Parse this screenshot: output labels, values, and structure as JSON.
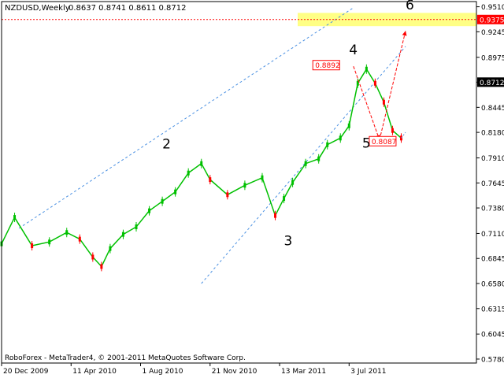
{
  "header": {
    "symbol": "NZDUSD,Weekly",
    "ohlc": "0.8637 0.8741 0.8611 0.8712"
  },
  "footer": {
    "copyright": "RoboForex - MetaTrader4, © 2001-2011 MetaQuotes Software Corp."
  },
  "colors": {
    "background": "#ffffff",
    "frame": "#000000",
    "bull": "#00c000",
    "bear": "#ff0000",
    "fractal": "#4a90e2",
    "channel": "#4a90e2",
    "level_line": "#ff0000",
    "target_zone": "#ffff66",
    "current_price_box": "#000000",
    "level_price_box": "#ff0000"
  },
  "chart_data": {
    "type": "candlestick",
    "title": "NZDUSD,Weekly",
    "ylim": [
      0.5738,
      0.9565
    ],
    "y_ticks": [
      0.951,
      0.9245,
      0.8975,
      0.8712,
      0.8445,
      0.818,
      0.791,
      0.7645,
      0.738,
      0.711,
      0.6845,
      0.658,
      0.6315,
      0.6045,
      0.578
    ],
    "x_ticks": [
      {
        "label": "20 Dec 2009",
        "date": "2009-12-20"
      },
      {
        "label": "11 Apr 2010",
        "date": "2010-04-11"
      },
      {
        "label": "1 Aug 2010",
        "date": "2010-08-01"
      },
      {
        "label": "21 Nov 2010",
        "date": "2010-11-21"
      },
      {
        "label": "13 Mar 2011",
        "date": "2011-03-13"
      },
      {
        "label": "3 Jul 2011",
        "date": "2011-07-03"
      }
    ],
    "x_start": "2009-12-20",
    "x_end": "2011-10-02",
    "series": [
      {
        "name": "close",
        "points": [
          [
            "2009-12-20",
            0.7
          ],
          [
            "2010-01-10",
            0.728
          ],
          [
            "2010-02-07",
            0.698
          ],
          [
            "2010-03-07",
            0.702
          ],
          [
            "2010-04-04",
            0.712
          ],
          [
            "2010-04-25",
            0.705
          ],
          [
            "2010-05-16",
            0.686
          ],
          [
            "2010-05-30",
            0.676
          ],
          [
            "2010-06-13",
            0.695
          ],
          [
            "2010-07-04",
            0.71
          ],
          [
            "2010-07-25",
            0.718
          ],
          [
            "2010-08-15",
            0.735
          ],
          [
            "2010-09-05",
            0.745
          ],
          [
            "2010-09-26",
            0.755
          ],
          [
            "2010-10-17",
            0.775
          ],
          [
            "2010-11-07",
            0.785
          ],
          [
            "2010-11-21",
            0.768
          ],
          [
            "2010-12-19",
            0.752
          ],
          [
            "2011-01-16",
            0.762
          ],
          [
            "2011-02-13",
            0.77
          ],
          [
            "2011-03-06",
            0.73
          ],
          [
            "2011-03-20",
            0.748
          ],
          [
            "2011-04-03",
            0.765
          ],
          [
            "2011-04-24",
            0.785
          ],
          [
            "2011-05-15",
            0.79
          ],
          [
            "2011-05-29",
            0.805
          ],
          [
            "2011-06-19",
            0.812
          ],
          [
            "2011-07-03",
            0.825
          ],
          [
            "2011-07-17",
            0.87
          ],
          [
            "2011-07-31",
            0.885
          ],
          [
            "2011-08-14",
            0.87
          ],
          [
            "2011-08-28",
            0.85
          ],
          [
            "2011-09-11",
            0.82
          ],
          [
            "2011-09-25",
            0.812
          ]
        ]
      },
      {
        "name": "continuation",
        "points": [
          [
            "2011-09-25",
            0.812
          ],
          [
            "2011-10-02",
            0.818
          ]
        ]
      }
    ],
    "levels": [
      {
        "value": 0.9375,
        "label": "0.9375",
        "style": "dashed",
        "color": "#ff0000"
      },
      {
        "value": 0.8712,
        "label": "0.8712",
        "style": "price",
        "color": "#000000"
      }
    ],
    "target_zone": {
      "y_from": 0.9305,
      "y_to": 0.9445
    },
    "channel": {
      "upper": [
        [
          "2010-01-17",
          0.7165
        ],
        [
          "2011-07-10",
          0.95
        ]
      ],
      "lower": [
        [
          "2010-11-07",
          0.658
        ],
        [
          "2011-10-02",
          0.909
        ]
      ]
    },
    "wave_labels": [
      {
        "label": "2",
        "date": "2010-09-05",
        "value": 0.801
      },
      {
        "label": "3",
        "date": "2011-03-20",
        "value": 0.6985
      },
      {
        "label": "4",
        "date": "2011-07-03",
        "value": 0.9005
      },
      {
        "label": "5",
        "date": "2011-07-24",
        "value": 0.802
      },
      {
        "label": "6",
        "date": "2011-10-02",
        "value": 0.948
      }
    ],
    "price_markers": [
      {
        "label": "0.8892",
        "date": "2011-06-05",
        "value": 0.8892
      },
      {
        "label": "0.8087",
        "date": "2011-09-04",
        "value": 0.8087
      }
    ],
    "arrows": [
      {
        "from": [
          "2011-07-10",
          0.888
        ],
        "to": [
          "2011-08-21",
          0.81
        ]
      },
      {
        "from": [
          "2011-08-21",
          0.81
        ],
        "to": [
          "2011-10-02",
          0.9255
        ]
      }
    ]
  }
}
